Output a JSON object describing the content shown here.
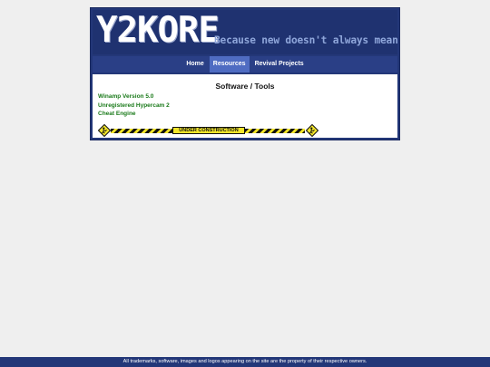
{
  "banner": {
    "logo": "Y2KORE",
    "tagline": "Because new doesn't always mean good"
  },
  "nav": {
    "items": [
      {
        "label": "Home",
        "active": false
      },
      {
        "label": "Resources",
        "active": true
      },
      {
        "label": "Revival Projects",
        "active": false
      }
    ]
  },
  "content": {
    "title": "Software / Tools",
    "links": [
      {
        "label": "Winamp Version 5.0"
      },
      {
        "label": "Unregistered Hypercam 2"
      },
      {
        "label": "Cheat Engine"
      }
    ]
  },
  "construction": {
    "label": "UNDER CONSTRUCTION"
  },
  "footer": {
    "text": "All trademarks, software, images and logos appearing on the site are the property of their respective owners."
  },
  "colors": {
    "header_bg": "#233778",
    "nav_active": "#4f6cc2",
    "link": "#1a7a1a",
    "stripe_yellow": "#f2e52a"
  }
}
